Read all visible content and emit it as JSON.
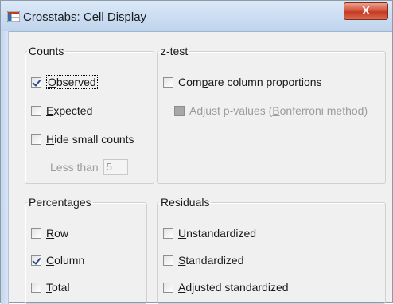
{
  "window": {
    "title": "Crosstabs: Cell Display",
    "close_label": "X"
  },
  "counts": {
    "legend": "Counts",
    "observed": {
      "prefix": "",
      "mnemonic": "O",
      "rest": "bserved",
      "checked": true
    },
    "expected": {
      "prefix": "",
      "mnemonic": "E",
      "rest": "xpected",
      "checked": false
    },
    "hide_small": {
      "prefix": "",
      "mnemonic": "H",
      "rest": "ide small counts",
      "checked": false
    },
    "less_than_label": "Less than",
    "less_than_value": "5"
  },
  "ztest": {
    "legend": "z-test",
    "compare": {
      "prefix": "Com",
      "mnemonic": "p",
      "rest": "are column proportions",
      "checked": false
    },
    "adjust": {
      "prefix": "Adjust p-values (",
      "mnemonic": "B",
      "rest": "onferroni method)",
      "checked": false,
      "disabled": true
    }
  },
  "percentages": {
    "legend": "Percentages",
    "row": {
      "prefix": "",
      "mnemonic": "R",
      "rest": "ow",
      "checked": false
    },
    "column": {
      "prefix": "",
      "mnemonic": "C",
      "rest": "olumn",
      "checked": true
    },
    "total": {
      "prefix": "",
      "mnemonic": "T",
      "rest": "otal",
      "checked": false
    }
  },
  "residuals": {
    "legend": "Residuals",
    "unstandardized": {
      "prefix": "",
      "mnemonic": "U",
      "rest": "nstandardized",
      "checked": false
    },
    "standardized": {
      "prefix": "",
      "mnemonic": "S",
      "rest": "tandardized",
      "checked": false
    },
    "adjusted": {
      "prefix": "",
      "mnemonic": "A",
      "rest": "djusted standardized",
      "checked": false
    }
  }
}
